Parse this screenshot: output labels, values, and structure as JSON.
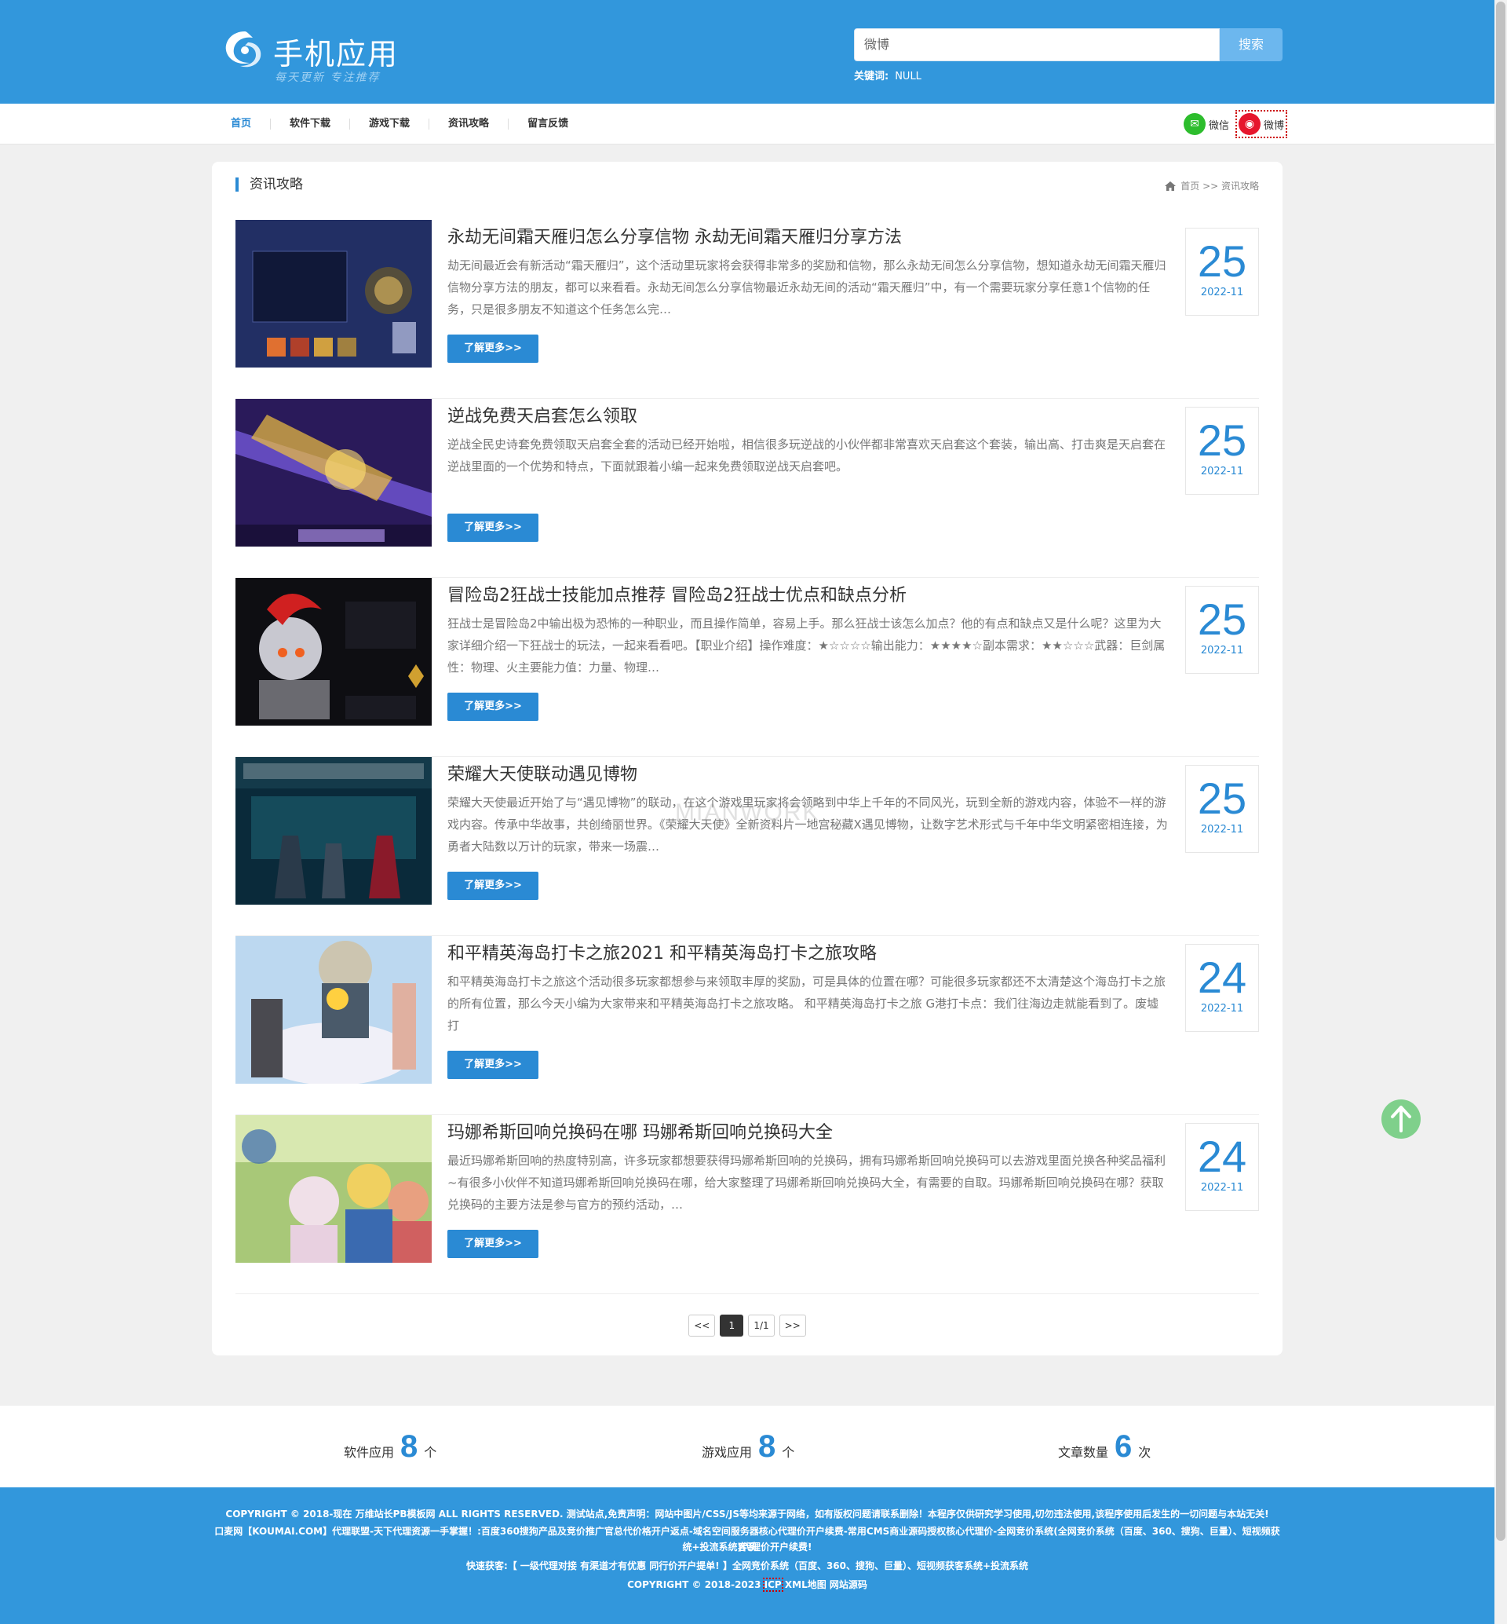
{
  "header": {
    "logo_title": "手机应用",
    "logo_slogan": "每天更新  专注推荐",
    "search_value": "微博",
    "search_button": "搜索",
    "keywords_label": "关键词:",
    "keywords_value": "NULL"
  },
  "nav": {
    "items": [
      "首页",
      "软件下载",
      "游戏下载",
      "资讯攻略",
      "留言反馈"
    ],
    "share_wechat": "微信",
    "share_weibo": "微博"
  },
  "section": {
    "title": "资讯攻略",
    "breadcrumb": "首页 >> 资讯攻略"
  },
  "articles": [
    {
      "title": "永劫无间霜天雁归怎么分享信物 永劫无间霜天雁归分享方法",
      "summary": "劫无间最近会有新活动“霜天雁归”，这个活动里玩家将会获得非常多的奖励和信物，那么永劫无间怎么分享信物，想知道永劫无间霜天雁归信物分享方法的朋友，都可以来看看。永劫无间怎么分享信物最近永劫无间的活动“霜天雁归”中，有一个需要玩家分享任意1个信物的任务，只是很多朋友不知道这个任务怎么完…",
      "more": "了解更多>>",
      "day": "25",
      "ym": "2022-11"
    },
    {
      "title": "逆战免费天启套怎么领取",
      "summary": "逆战全民史诗套免费领取天启套全套的活动已经开始啦，相信很多玩逆战的小伙伴都非常喜欢天启套这个套装，输出高、打击爽是天启套在逆战里面的一个优势和特点，下面就跟着小编一起来免费领取逆战天启套吧。",
      "more": "了解更多>>",
      "day": "25",
      "ym": "2022-11"
    },
    {
      "title": "冒险岛2狂战士技能加点推荐 冒险岛2狂战士优点和缺点分析",
      "summary": "狂战士是冒险岛2中输出极为恐怖的一种职业，而且操作简单，容易上手。那么狂战士该怎么加点？他的有点和缺点又是什么呢？这里为大家详细介绍一下狂战士的玩法，一起来看看吧。【职业介绍】操作难度：★☆☆☆☆输出能力：★★★★☆副本需求：★★☆☆☆武器：巨剑属性：物理、火主要能力值：力量、物理…",
      "more": "了解更多>>",
      "day": "25",
      "ym": "2022-11"
    },
    {
      "title": "荣耀大天使联动遇见博物",
      "summary": "荣耀大天使最近开始了与“遇见博物”的联动，在这个游戏里玩家将会领略到中华上千年的不同风光，玩到全新的游戏内容，体验不一样的游戏内容。传承中华故事，共创绮丽世界。《荣耀大天使》全新资料片一地宫秘藏X遇见博物，让数字艺术形式与千年中华文明紧密相连接，为勇者大陆数以万计的玩家，带来一场震…",
      "more": "了解更多>>",
      "day": "25",
      "ym": "2022-11"
    },
    {
      "title": "和平精英海岛打卡之旅2021 和平精英海岛打卡之旅攻略",
      "summary": "和平精英海岛打卡之旅这个活动很多玩家都想参与来领取丰厚的奖励，可是具体的位置在哪？可能很多玩家都还不太清楚这个海岛打卡之旅的所有位置，那么今天小编为大家带来和平精英海岛打卡之旅攻略。 和平精英海岛打卡之旅 G港打卡点：我们往海边走就能看到了。废墟打",
      "more": "了解更多>>",
      "day": "24",
      "ym": "2022-11"
    },
    {
      "title": "玛娜希斯回响兑换码在哪 玛娜希斯回响兑换码大全",
      "summary": "最近玛娜希斯回响的热度特别高，许多玩家都想要获得玛娜希斯回响的兑换码，拥有玛娜希斯回响兑换码可以去游戏里面兑换各种奖品福利~有很多小伙伴不知道玛娜希斯回响兑换码在哪，给大家整理了玛娜希斯回响兑换码大全，有需要的自取。玛娜希斯回响兑换码在哪？获取兑换码的主要方法是参与官方的预约活动，…",
      "more": "了解更多>>",
      "day": "24",
      "ym": "2022-11"
    }
  ],
  "pager": {
    "prev": "<<",
    "current": "1",
    "info": "1/1",
    "next": ">>"
  },
  "watermark": "MIANWORK",
  "stats": [
    {
      "label": "软件应用",
      "value": "8",
      "unit": "个"
    },
    {
      "label": "游戏应用",
      "value": "8",
      "unit": "个"
    },
    {
      "label": "文章数量",
      "value": "6",
      "unit": "次"
    }
  ],
  "footer": {
    "line1": "COPYRIGHT © 2018-现在 万维站长PB模板网 ALL RIGHTS RESERVED. 测试站点,免责声明：网站中图片/CSS/JS等均来源于网络，如有版权问题请联系删除！本程序仅供研究学习使用,切勿违法使用,该程序使用后发生的一切问题与本站无关!",
    "line2": "口麦网【KOUMAI.COM】代理联盟-天下代理资源一手掌握！:百度360搜狗产品及竞价推广官总代价格开户返点-域名空间服务器核心代理价开户续费-常用CMS商业源码授权核心代理价-全网竞价系统(全网竞价系统（百度、360、搜狗、巨量）、短视频获客系",
    "line3": "统+投流系统)代理价开户续费!",
    "line4": "快速获客:【 一级代理对接 有渠道才有优惠 同行价开户提单! 】全网竞价系统（百度、360、搜狗、巨量）、短视频获客系统+投流系统",
    "line5_a": "COPYRIGHT © 2018-2023 ",
    "line5_icp": "ICP",
    "line5_b": " XML地图 网站源码"
  }
}
